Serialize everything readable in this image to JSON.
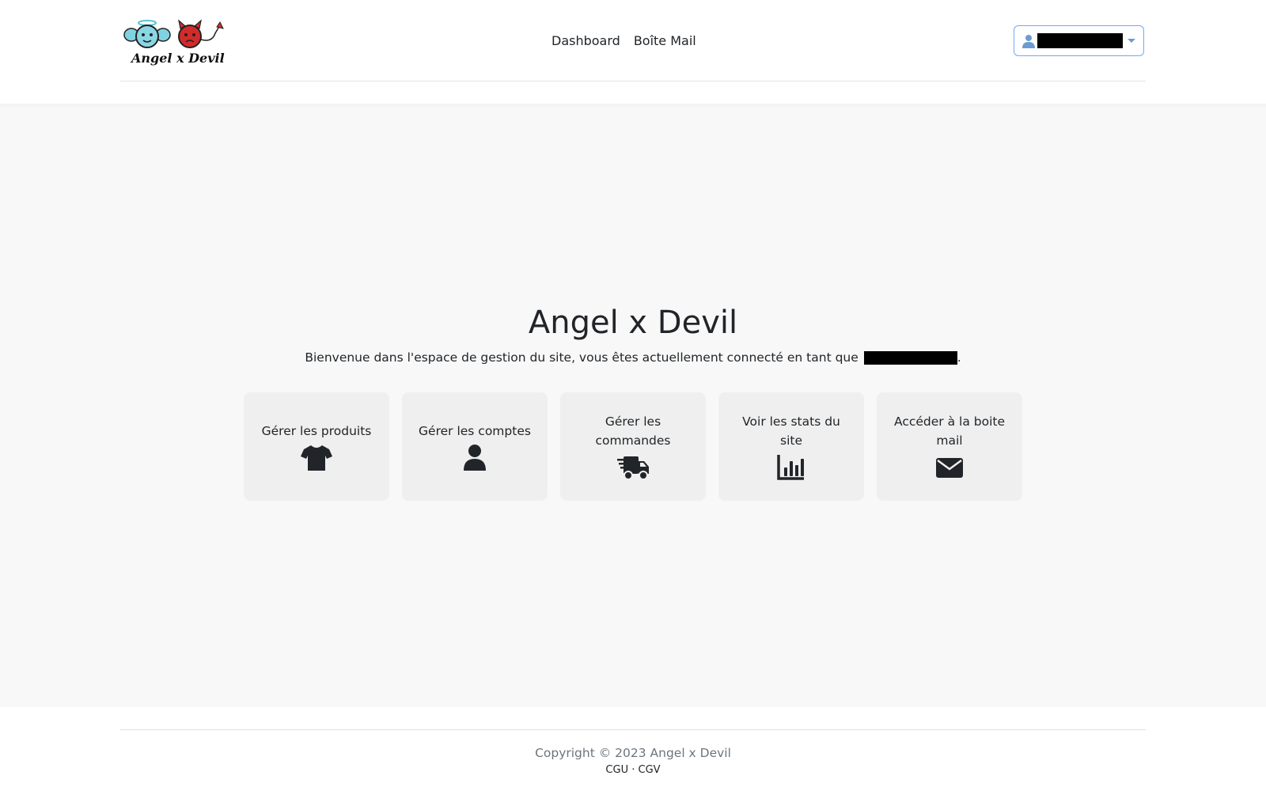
{
  "brand": {
    "logo_text": "Angel x Devil"
  },
  "nav": {
    "items": [
      {
        "label": "Dashboard"
      },
      {
        "label": "Boîte Mail"
      }
    ]
  },
  "user_menu": {
    "icon": "user-icon"
  },
  "hero": {
    "title": "Angel x Devil",
    "welcome_text": "Bienvenue dans l'espace de gestion du site, vous êtes actuellement connecté en tant que",
    "welcome_suffix": "."
  },
  "cards": [
    {
      "label": "Gérer les produits",
      "icon": "tshirt-icon"
    },
    {
      "label": "Gérer les comptes",
      "icon": "user-icon"
    },
    {
      "label": "Gérer les commandes",
      "icon": "truck-icon"
    },
    {
      "label": "Voir les stats du site",
      "icon": "chart-icon"
    },
    {
      "label": "Accéder à la boite mail",
      "icon": "envelope-icon"
    }
  ],
  "footer": {
    "copyright": "Copyright © 2023 Angel x Devil",
    "links": [
      {
        "label": "CGU"
      },
      {
        "label": "CGV"
      }
    ],
    "separator": "·"
  },
  "colors": {
    "accent": "#6ea8fe",
    "text": "#212529",
    "card_bg": "#efefef",
    "main_bg": "#f8f8f8"
  }
}
